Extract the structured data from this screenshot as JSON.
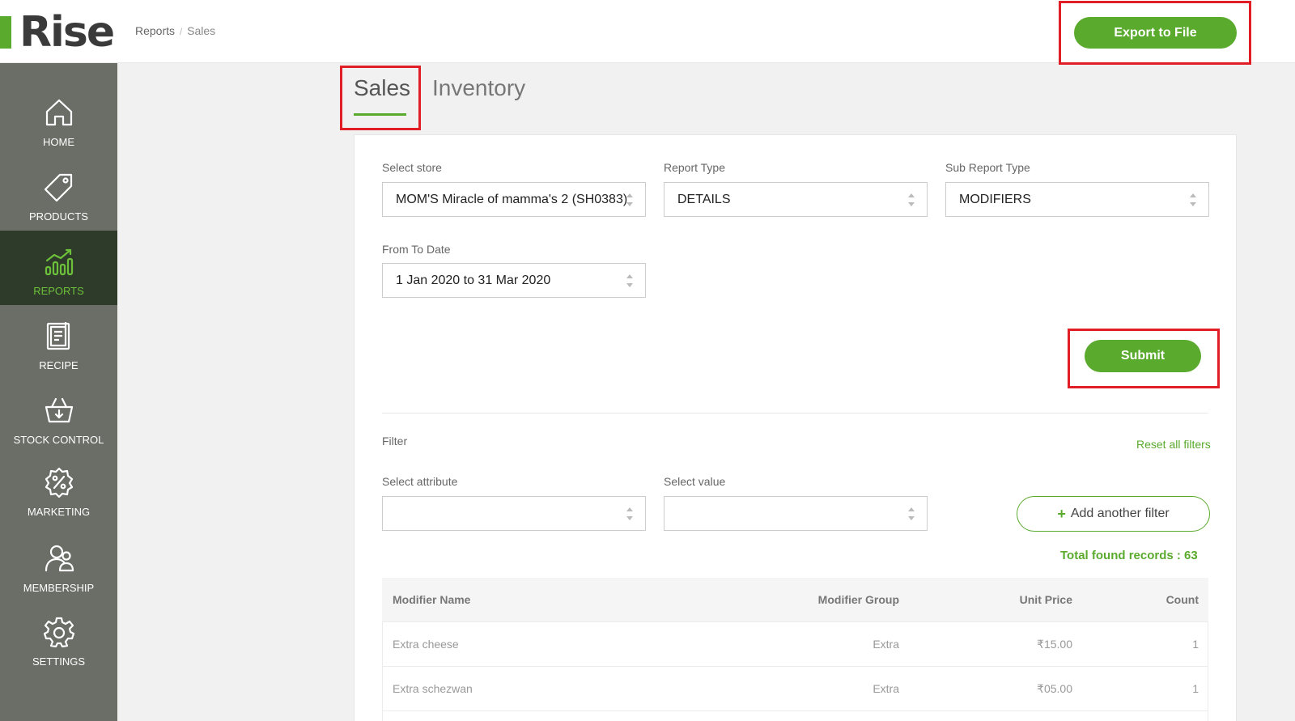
{
  "header": {
    "logo_text": "Rise",
    "breadcrumb": {
      "parent": "Reports",
      "separator": "/",
      "current": "Sales"
    },
    "export_label": "Export to File"
  },
  "sidebar": {
    "items": [
      {
        "label": "HOME",
        "icon": "home-icon"
      },
      {
        "label": "PRODUCTS",
        "icon": "tag-icon"
      },
      {
        "label": "REPORTS",
        "icon": "chart-icon",
        "active": true
      },
      {
        "label": "RECIPE",
        "icon": "clipboard-icon"
      },
      {
        "label": "STOCK CONTROL",
        "icon": "basket-icon"
      },
      {
        "label": "MARKETING",
        "icon": "percent-badge-icon"
      },
      {
        "label": "MEMBERSHIP",
        "icon": "users-icon"
      },
      {
        "label": "SETTINGS",
        "icon": "gear-icon"
      }
    ]
  },
  "tabs": [
    {
      "label": "Sales",
      "active": true
    },
    {
      "label": "Inventory"
    }
  ],
  "form": {
    "store": {
      "label": "Select store",
      "value": "MOM'S Miracle of mamma's 2 (SH0383)"
    },
    "report_type": {
      "label": "Report Type",
      "value": "DETAILS"
    },
    "sub_report_type": {
      "label": "Sub Report Type",
      "value": "MODIFIERS"
    },
    "date": {
      "label": "From To Date",
      "value": "1 Jan 2020 to 31 Mar 2020"
    },
    "submit_label": "Submit"
  },
  "filter": {
    "title": "Filter",
    "reset_label": "Reset all filters",
    "attribute_label": "Select attribute",
    "attribute_value": "",
    "value_label": "Select value",
    "value_value": "",
    "add_label": "Add another filter"
  },
  "results": {
    "total_label": "Total found records : 63",
    "columns": [
      "Modifier Name",
      "Modifier Group",
      "Unit Price",
      "Count"
    ],
    "rows": [
      [
        "Extra cheese",
        "Extra",
        "₹15.00",
        "1"
      ],
      [
        "Extra schezwan",
        "Extra",
        "₹05.00",
        "1"
      ]
    ]
  },
  "colors": {
    "brand_green": "#5aaa2e",
    "sidebar_bg": "#6b6d67",
    "highlight_red": "#e11d26"
  }
}
